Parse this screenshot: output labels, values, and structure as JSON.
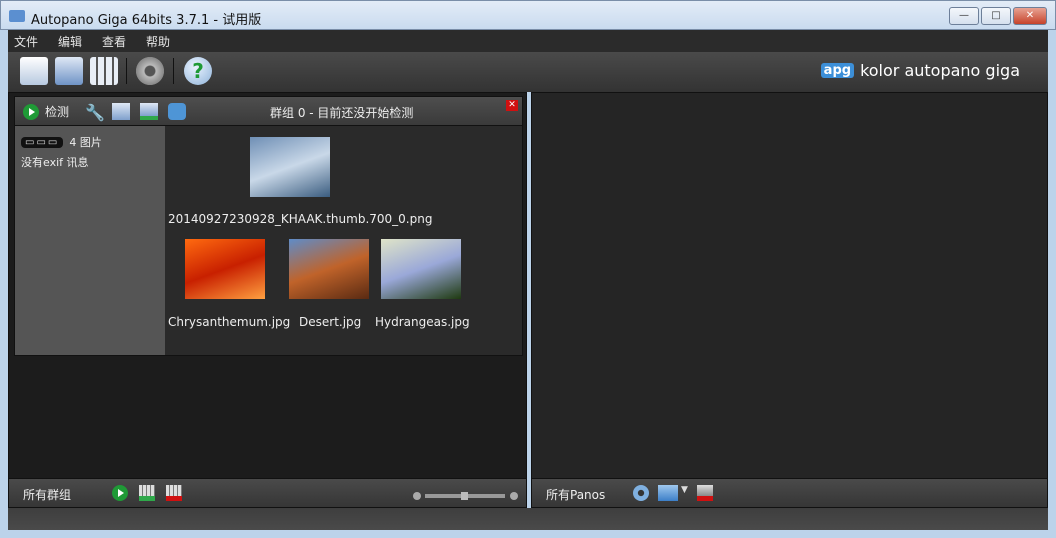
{
  "window": {
    "title": "Autopano Giga 64bits 3.7.1 - 试用版",
    "minimize": "—",
    "maximize": "□",
    "close": "✕"
  },
  "menu": [
    "文件",
    "编辑",
    "查看",
    "帮助"
  ],
  "toolbar": {
    "brand_badge": "apg",
    "brand_name": "kolor autopano giga"
  },
  "group": {
    "detect_label": "检测",
    "title": "群组 0 - 目前还没开始检测",
    "close": "✕",
    "image_count": "4 图片",
    "pill": "▭▭▭",
    "exif": "没有exif 讯息",
    "images": [
      {
        "name": "20140927230928_KHAAK.thumb.700_0.png",
        "colors": [
          "#6f8fb5",
          "#c9d8e8",
          "#3b5d80"
        ]
      },
      {
        "name": "Chrysanthemum.jpg",
        "colors": [
          "#ff6a10",
          "#c82000",
          "#ffa040"
        ]
      },
      {
        "name": "Desert.jpg",
        "colors": [
          "#5f8cc8",
          "#c0632a",
          "#5a2a12"
        ]
      },
      {
        "name": "Hydrangeas.jpg",
        "colors": [
          "#dfe4c8",
          "#9aa8d8",
          "#1f3a10"
        ]
      }
    ]
  },
  "left_bottom": {
    "label": "所有群组"
  },
  "right_bottom": {
    "label": "所有Panos"
  },
  "zoom_level": 0.45
}
